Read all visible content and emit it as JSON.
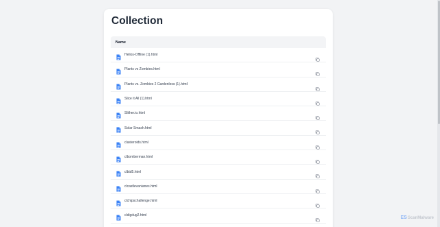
{
  "page": {
    "title": "Collection"
  },
  "table": {
    "header": "Name",
    "rows": [
      "Helios-Offline (1).html",
      "Plants vs Zombies.html",
      "Plants vs. Zombies 2 Gardenless (1).html",
      "Slice it All (1).html",
      "Slither.io.html",
      "Solar Smash.html",
      "clasteroids.html",
      "clbomberman.html",
      "clbtd5.html",
      "clcastlevanianes.html",
      "clchipschallenge.html",
      "cldigdug2.html"
    ]
  },
  "icons": {
    "file": "file-icon",
    "copy": "copy-icon"
  },
  "colors": {
    "accent": "#3b82f6",
    "background": "#f2f3f5"
  },
  "watermark": {
    "logo": "ES",
    "text": "ScanMalware"
  }
}
